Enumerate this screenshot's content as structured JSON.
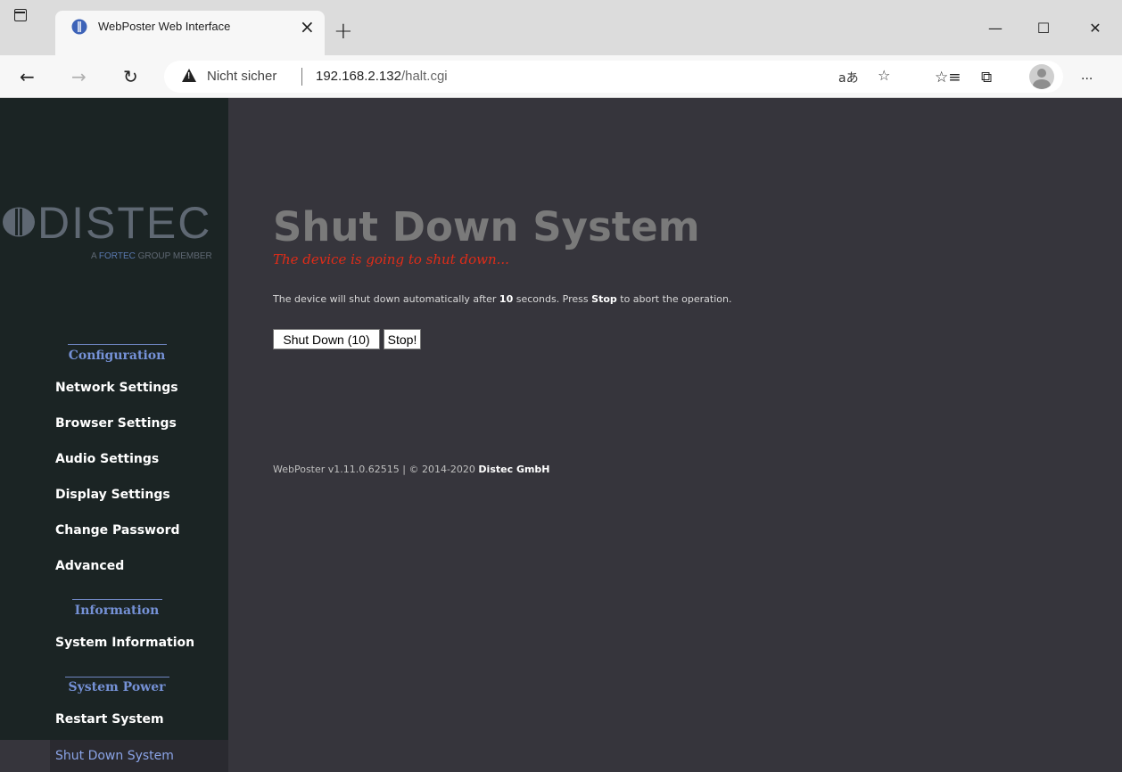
{
  "browser": {
    "tab_title": "WebPoster Web Interface",
    "tab_close": "×",
    "new_tab": "+",
    "minimize": "—",
    "maximize": "☐",
    "close": "✕",
    "not_secure": "Nicht sicher",
    "url_host": "192.168.2.132",
    "url_path": "/halt.cgi",
    "read_aloud_glyph": "aあ",
    "more_glyph": "···"
  },
  "sidebar": {
    "logo_text": "DISTEC",
    "logo_sub_prefix": "A ",
    "logo_sub_accent": "FORTEC",
    "logo_sub_suffix": " GROUP MEMBER",
    "sections": {
      "configuration": "Configuration",
      "information": "Information",
      "system_power": "System Power"
    },
    "links": {
      "network": "Network Settings",
      "browser": "Browser Settings",
      "audio": "Audio Settings",
      "display": "Display Settings",
      "password": "Change Password",
      "advanced": "Advanced",
      "system_info": "System Information",
      "restart": "Restart System",
      "shutdown": "Shut Down System"
    }
  },
  "main": {
    "title": "Shut Down System",
    "subtitle": "The device is going to shut down...",
    "desc_prefix": "The device will shut down automatically after ",
    "desc_seconds": "10",
    "desc_middle": " seconds. Press ",
    "desc_stop": "Stop",
    "desc_suffix": " to abort the operation.",
    "shutdown_button": "Shut Down (10)",
    "stop_button": "Stop!",
    "footer_prefix": "WebPoster v1.11.0.62515 | © 2014-2020 ",
    "footer_company": "Distec GmbH"
  },
  "colors": {
    "page_bg": "#36353c",
    "sidebar_bg": "#1b2424",
    "title_gray": "#7a7a7a",
    "subtitle_red": "#e02c18",
    "section_blue": "#7591d6"
  }
}
